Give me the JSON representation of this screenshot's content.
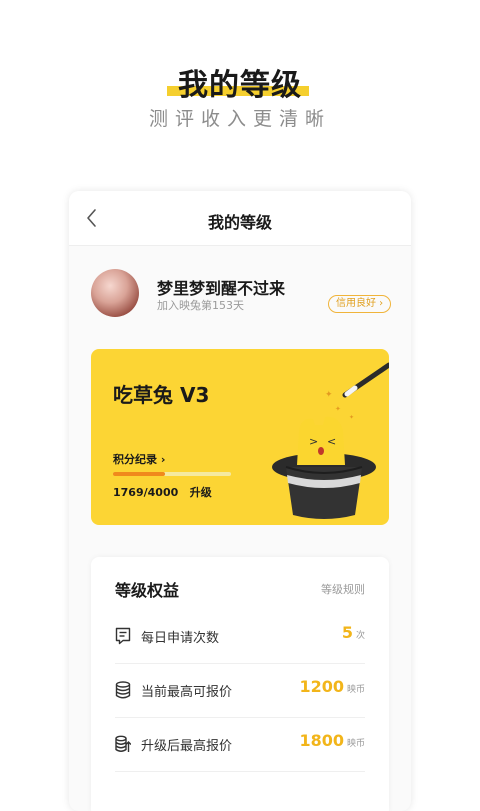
{
  "promo": {
    "title": "我的等级",
    "subtitle": "测评收入更清晰"
  },
  "nav": {
    "title": "我的等级"
  },
  "user": {
    "name": "梦里梦到醒不过来",
    "joined": "加入映兔第153天",
    "credit_badge": "信用良好 ›"
  },
  "level": {
    "name": "吃草兔 V3",
    "record_link": "积分纪录 ›",
    "progress": 0.44,
    "points": "1769/4000",
    "upgrade": "升级"
  },
  "benefits": {
    "title": "等级权益",
    "rules_link": "等级规则",
    "rows": [
      {
        "icon": "document-icon",
        "label": "每日申请次数",
        "value": "5",
        "unit": "次"
      },
      {
        "icon": "coin-stack-icon",
        "label": "当前最高可报价",
        "value": "1200",
        "unit": "映币"
      },
      {
        "icon": "coin-upgrade-icon",
        "label": "升级后最高报价",
        "value": "1800",
        "unit": "映币"
      }
    ]
  },
  "colors": {
    "accent_yellow": "#fcd534",
    "value_gold": "#f2b51a",
    "progress_orange": "#f08a1c",
    "badge_orange": "#e0a020"
  }
}
